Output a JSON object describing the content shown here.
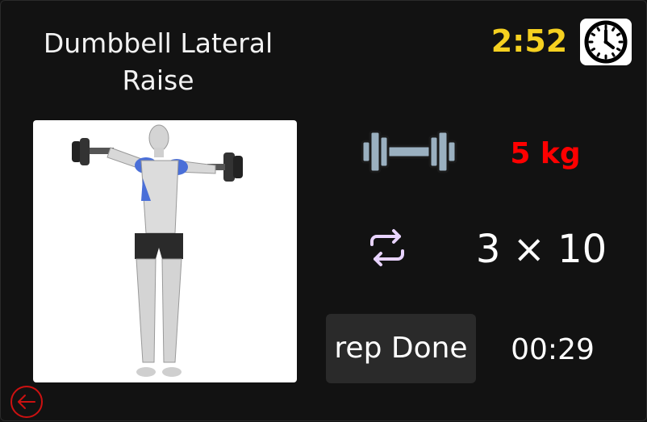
{
  "header": {
    "exercise_title": "Dumbbell Lateral Raise",
    "session_timer": "2:52",
    "clock_icon": "clock-icon"
  },
  "exercise": {
    "image_icon": "exercise-illustration",
    "weight": "5 kg",
    "weight_icon": "dumbbell-icon",
    "sets_reps": "3 × 10",
    "sets_icon": "repeat-icon"
  },
  "controls": {
    "rep_done_label": "rep Done",
    "rest_timer": "00:29",
    "back_icon": "back-arrow-icon"
  },
  "colors": {
    "background": "#121212",
    "timer": "#f5d020",
    "weight": "#ff0000",
    "button_bg": "#2a2a2a",
    "back_button": "#cc1111",
    "repeat_icon": "#e8d3ff",
    "muscle_highlight": "#4a6fd8"
  }
}
